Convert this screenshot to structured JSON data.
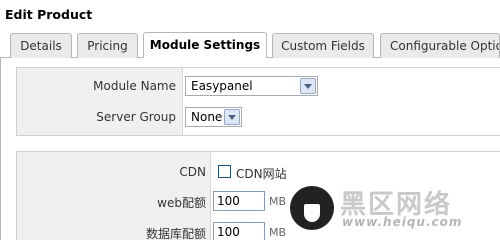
{
  "window": {
    "title": "Edit Product"
  },
  "tabs": [
    {
      "label": "Details"
    },
    {
      "label": "Pricing"
    },
    {
      "label": "Module Settings"
    },
    {
      "label": "Custom Fields"
    },
    {
      "label": "Configurable Optio"
    }
  ],
  "active_tab": "Module Settings",
  "module": {
    "module_name_label": "Module Name",
    "module_name_value": "Easypanel",
    "server_group_label": "Server Group",
    "server_group_value": "None"
  },
  "options": {
    "cdn_label": "CDN",
    "cdn_checkbox_label": "CDN网站",
    "cdn_checked": false,
    "web_quota_label": "web配额",
    "web_quota_value": "100",
    "web_quota_unit": "MB",
    "db_quota_label": "数据库配额",
    "db_quota_value": "100",
    "db_quota_unit": "MB"
  },
  "watermark": {
    "text": "黑区网络",
    "url": "www.heiqu.com"
  }
}
